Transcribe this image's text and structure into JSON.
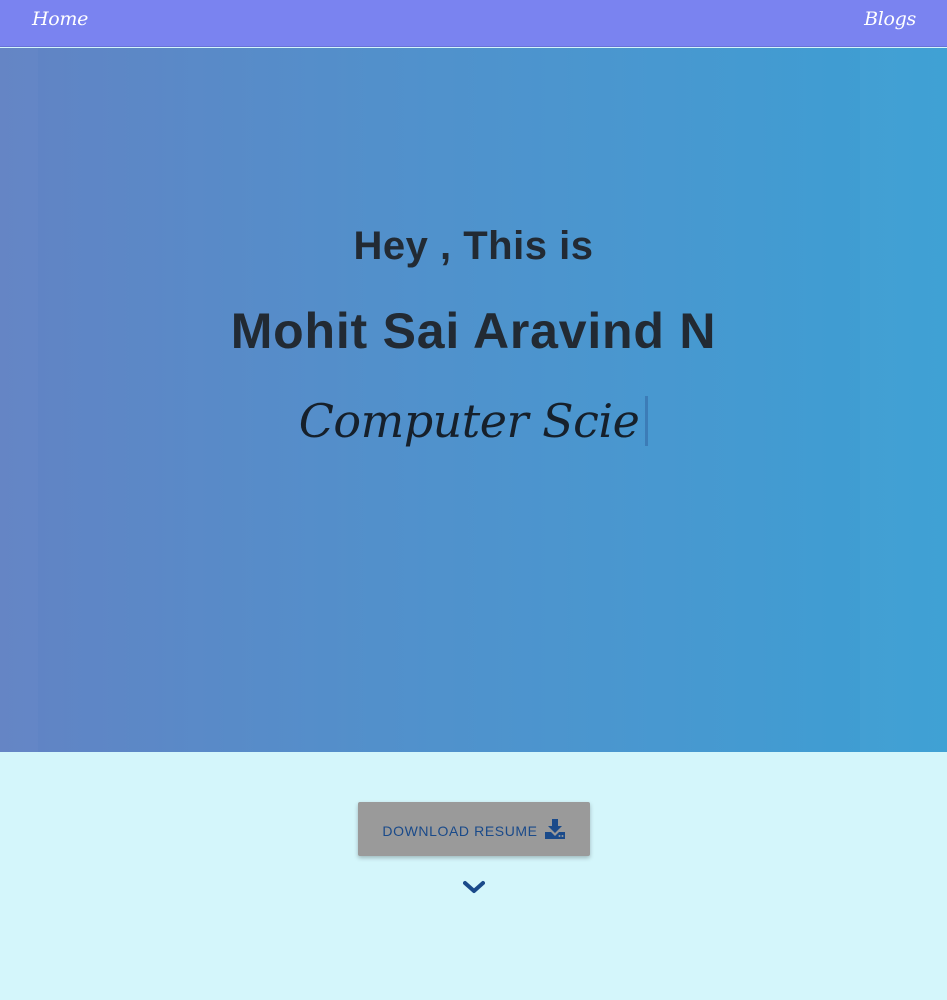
{
  "nav": {
    "home_label": "Home",
    "blogs_label": "Blogs"
  },
  "hero": {
    "greeting": "Hey , This is",
    "name": "Mohit Sai Aravind N",
    "typed_text": "Computer Scie"
  },
  "resume": {
    "button_label": "DOWNLOAD RESUME",
    "icon": "download-icon"
  },
  "scroll": {
    "icon": "chevron-down-icon"
  },
  "colors": {
    "navbar": "#7a83f0",
    "hero_left": "#6283c4",
    "hero_right": "#3b9fd3",
    "page_background": "#d4f6fb",
    "button_background": "#9a9a9a",
    "accent_blue": "#1a4a8a"
  }
}
